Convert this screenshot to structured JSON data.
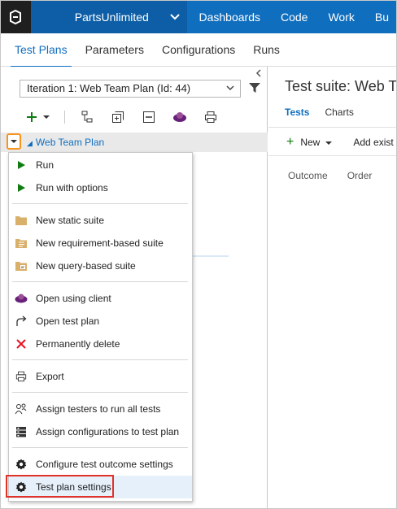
{
  "topbar": {
    "project": "PartsUnlimited",
    "nav": [
      "Dashboards",
      "Code",
      "Work",
      "Bu"
    ]
  },
  "hub_tabs": [
    {
      "label": "Test Plans",
      "active": true
    },
    {
      "label": "Parameters",
      "active": false
    },
    {
      "label": "Configurations",
      "active": false
    },
    {
      "label": "Runs",
      "active": false
    }
  ],
  "left": {
    "iteration_value": "Iteration 1: Web Team Plan (Id: 44)",
    "tree_item": "Web Team Plan"
  },
  "right": {
    "title": "Test suite: Web Te",
    "tabs": [
      {
        "label": "Tests",
        "active": true
      },
      {
        "label": "Charts",
        "active": false
      }
    ],
    "new_label": "New",
    "add_existing": "Add exist",
    "columns": [
      "Outcome",
      "Order"
    ]
  },
  "menu": {
    "items": [
      {
        "label": "Run",
        "icon": "play-icon"
      },
      {
        "label": "Run with options",
        "icon": "play-icon"
      },
      {
        "label": "New static suite",
        "icon": "folder-icon"
      },
      {
        "label": "New requirement-based suite",
        "icon": "requirement-suite-icon"
      },
      {
        "label": "New query-based suite",
        "icon": "query-suite-icon"
      },
      {
        "label": "Open using client",
        "icon": "client-icon"
      },
      {
        "label": "Open test plan",
        "icon": "open-arrow-icon"
      },
      {
        "label": "Permanently delete",
        "icon": "delete-x-icon"
      },
      {
        "label": "Export",
        "icon": "printer-icon"
      },
      {
        "label": "Assign testers to run all tests",
        "icon": "assign-testers-icon"
      },
      {
        "label": "Assign configurations to test plan",
        "icon": "configurations-icon"
      },
      {
        "label": "Configure test outcome settings",
        "icon": "gear-icon"
      },
      {
        "label": "Test plan settings",
        "icon": "gear-icon"
      }
    ]
  },
  "colors": {
    "accent": "#106ebe",
    "topbar": "#106ebe",
    "highlight_border": "#e0322a",
    "dropdown_focus": "#f7941e",
    "play_green": "#107c10",
    "delete_red": "#e81123"
  }
}
